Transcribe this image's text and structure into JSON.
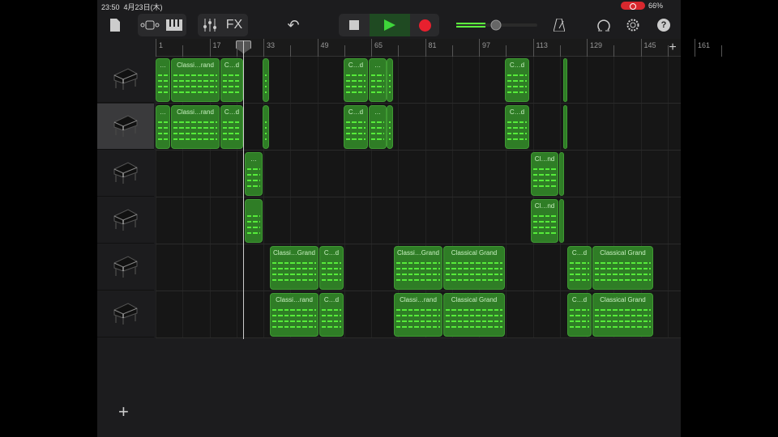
{
  "status": {
    "time": "23:50",
    "date": "4月23日(木)",
    "battery": "66%"
  },
  "toolbar": {
    "fx_label": "FX",
    "icons": [
      "document-icon",
      "tracks-view-icon",
      "keyboard-icon",
      "mixer-icon",
      "fx-icon",
      "undo-icon",
      "stop-icon",
      "play-icon",
      "record-icon",
      "volume-slider",
      "metronome-icon",
      "loop-icon",
      "settings-icon",
      "help-icon"
    ],
    "play_color": "#3ed63a",
    "record_color": "#e8202e",
    "volume_level": 0.45
  },
  "ruler": {
    "markers": [
      "1",
      "17",
      "33",
      "49",
      "65",
      "81",
      "97",
      "113",
      "129",
      "145",
      "161"
    ],
    "add_label": "+"
  },
  "tracks": [
    {
      "instrument": "grand-piano",
      "selected": false,
      "regions": [
        "…",
        "Classi…rand",
        "C…d",
        "",
        "C…d",
        "…",
        "",
        "C…d",
        ""
      ]
    },
    {
      "instrument": "grand-piano",
      "selected": true,
      "regions": [
        "…",
        "Classi…rand",
        "C…d",
        "",
        "C…d",
        "…",
        "",
        "C…d",
        ""
      ]
    },
    {
      "instrument": "grand-piano",
      "selected": false,
      "regions": [
        "…",
        "Cl…nd",
        ""
      ]
    },
    {
      "instrument": "grand-piano",
      "selected": false,
      "regions": [
        "",
        "Cl…nd",
        ""
      ]
    },
    {
      "instrument": "grand-piano",
      "selected": false,
      "regions": [
        "Classi…Grand",
        "C…d",
        "Classi…Grand",
        "Classical Grand",
        "C…d",
        "Classical Grand"
      ]
    },
    {
      "instrument": "grand-piano",
      "selected": false,
      "regions": [
        "Classi…rand",
        "C…d",
        "Classi…rand",
        "Classical Grand",
        "C…d",
        "Classical Grand"
      ]
    }
  ],
  "add_track_label": "+",
  "colors": {
    "region": "#2f7d26",
    "notes": "#5dff3e",
    "background": "#1c1c1e"
  }
}
